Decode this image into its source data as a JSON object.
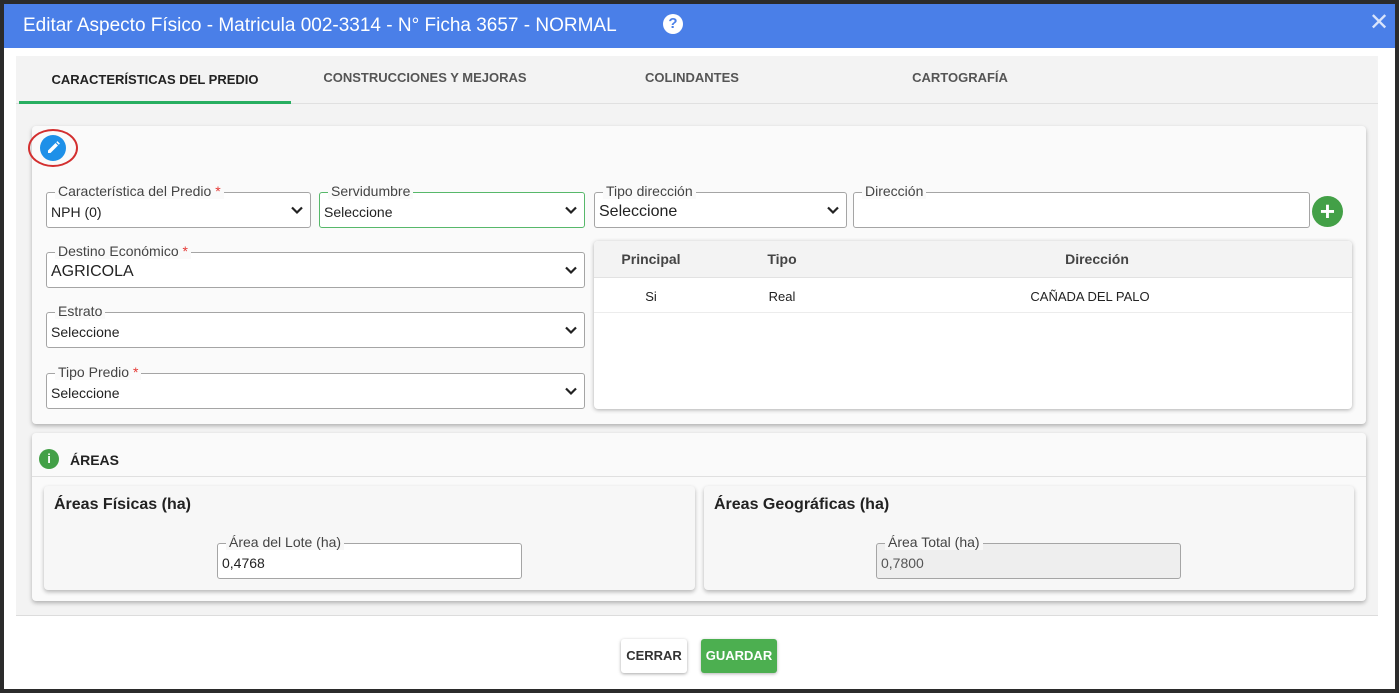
{
  "dialog": {
    "title": "Editar Aspecto Físico - Matricula 002-3314 - N° Ficha 3657 - NORMAL",
    "help_icon": "?",
    "close_icon": "✕",
    "colors": {
      "title_bar": "#4a7fe8",
      "accent_green": "#27ae60",
      "add_button": "#43a047",
      "edit_button": "#1e90e8",
      "required": "#e53935"
    }
  },
  "tabs": [
    {
      "label": "CARACTERÍSTICAS DEL PREDIO",
      "active": true
    },
    {
      "label": "CONSTRUCCIONES Y MEJORAS",
      "active": false
    },
    {
      "label": "COLINDANTES",
      "active": false
    },
    {
      "label": "CARTOGRAFÍA",
      "active": false
    }
  ],
  "form": {
    "edit_icon": "pencil-icon",
    "caracteristica": {
      "label": "Característica del Predio",
      "required_mark": "*",
      "value": "NPH (0)"
    },
    "servidumbre": {
      "label": "Servidumbre",
      "value": "Seleccione"
    },
    "tipo_direccion": {
      "label": "Tipo dirección",
      "value": "Seleccione"
    },
    "direccion": {
      "label": "Dirección",
      "value": ""
    },
    "add_button": "+",
    "destino": {
      "label": "Destino Económico",
      "required_mark": "*",
      "value": "AGRICOLA"
    },
    "estrato": {
      "label": "Estrato",
      "value": "Seleccione"
    },
    "tipo_predio": {
      "label": "Tipo Predio",
      "required_mark": "*",
      "value": "Seleccione"
    }
  },
  "address_table": {
    "headers": {
      "principal": "Principal",
      "tipo": "Tipo",
      "direccion": "Dirección"
    },
    "rows": [
      {
        "principal": "Si",
        "tipo": "Real",
        "direccion": "CAÑADA DEL PALO"
      }
    ]
  },
  "areas": {
    "section_title": "ÁREAS",
    "info_icon": "i",
    "fisicas": {
      "title": "Áreas Físicas (ha)",
      "field_label": "Área del Lote (ha)",
      "value": "0,4768"
    },
    "geograficas": {
      "title": "Áreas Geográficas (ha)",
      "field_label": "Área Total (ha)",
      "value": "0,7800"
    }
  },
  "footer": {
    "close_label": "CERRAR",
    "save_label": "GUARDAR"
  }
}
